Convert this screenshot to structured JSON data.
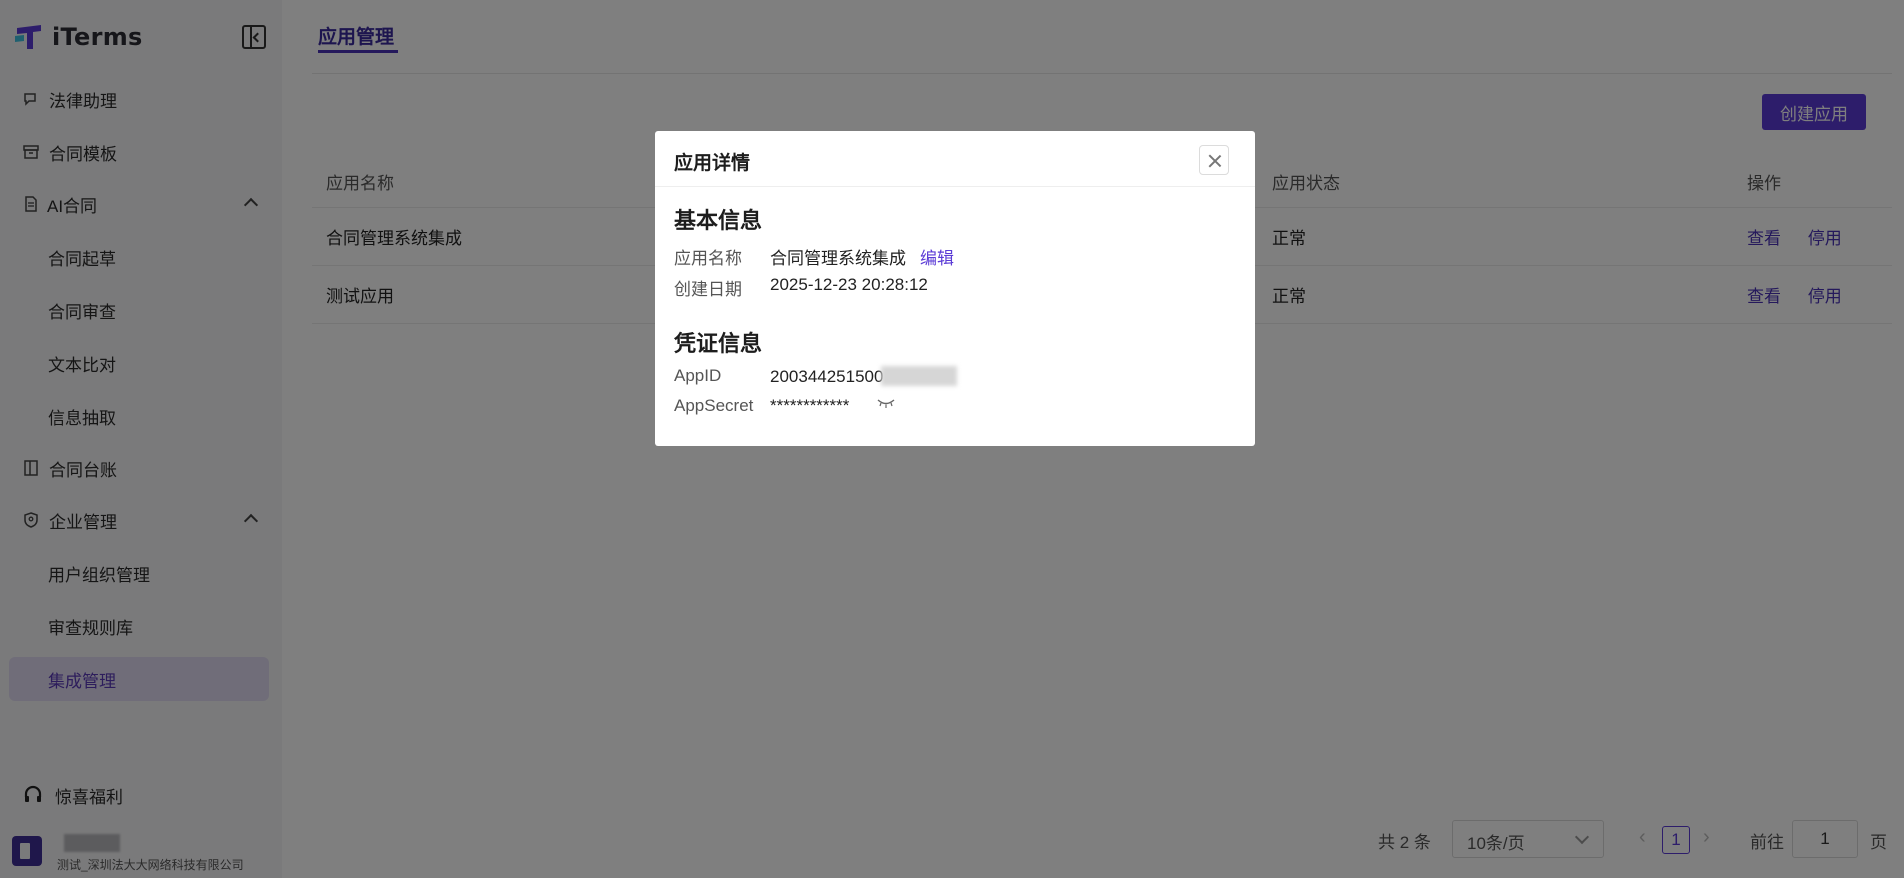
{
  "app": {
    "logo_text": "iTerms"
  },
  "sidebar": {
    "items": [
      {
        "label": "法律助理"
      },
      {
        "label": "合同模板"
      },
      {
        "label": "AI合同"
      },
      {
        "label": "合同起草"
      },
      {
        "label": "合同审查"
      },
      {
        "label": "文本比对"
      },
      {
        "label": "信息抽取"
      },
      {
        "label": "合同台账"
      },
      {
        "label": "企业管理"
      },
      {
        "label": "用户组织管理"
      },
      {
        "label": "审查规则库"
      },
      {
        "label": "集成管理"
      }
    ],
    "bottom_label": "惊喜福利",
    "user_org": "测试_深圳法大大网络科技有限公司"
  },
  "main": {
    "tab_label": "应用管理",
    "create_button": "创建应用",
    "table": {
      "headers": {
        "name": "应用名称",
        "status": "应用状态",
        "ops": "操作"
      },
      "rows": [
        {
          "name": "合同管理系统集成",
          "status": "正常",
          "view": "查看",
          "disable": "停用"
        },
        {
          "name": "测试应用",
          "status": "正常",
          "view": "查看",
          "disable": "停用"
        }
      ]
    },
    "pagination": {
      "total": "共 2 条",
      "page_size": "10条/页",
      "current_page": "1",
      "goto_label": "前往",
      "goto_value": "1",
      "page_word": "页"
    }
  },
  "modal": {
    "title": "应用详情",
    "basic_section": "基本信息",
    "fields": {
      "app_name_label": "应用名称",
      "app_name_value": "合同管理系统集成",
      "edit_label": "编辑",
      "created_label": "创建日期",
      "created_value": "2025-12-23 20:28:12"
    },
    "credential_section": "凭证信息",
    "credentials": {
      "appid_label": "AppID",
      "appid_value": "200344251500",
      "secret_label": "AppSecret",
      "secret_value": "************"
    }
  },
  "colors": {
    "accent": "#5b3bd6",
    "status_ok": "#3ea34a"
  }
}
